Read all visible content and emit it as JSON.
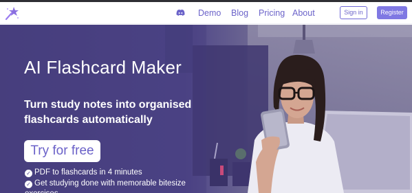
{
  "nav": {
    "links": [
      "Demo",
      "Blog",
      "Pricing",
      "About"
    ],
    "signin_label": "Sign in",
    "register_label": "Register",
    "logo_icon": "sparkle-wand-icon",
    "discord_icon": "discord-icon"
  },
  "hero": {
    "title": "AI Flashcard Maker",
    "subtitle": "Turn study notes into organised flashcards automatically",
    "cta_label": "Try for free",
    "features": [
      "PDF to flashcards in 4 minutes",
      "Get studying done with memorable bitesize",
      "exercises"
    ]
  },
  "colors": {
    "accent": "#6b63c9",
    "button_fill": "#7f78e3",
    "hero_overlay": "#4c4384"
  }
}
